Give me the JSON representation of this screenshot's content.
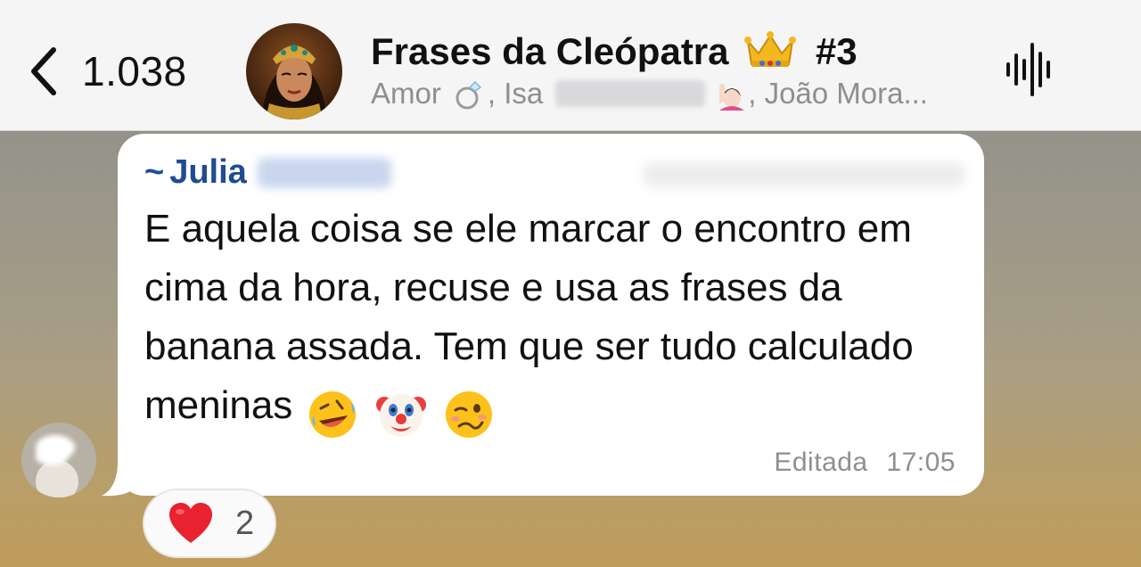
{
  "header": {
    "back_count": "1.038",
    "group_name": "Frases da Cleópatra",
    "title_suffix": "#3",
    "participants": {
      "first": "Amor",
      "second": "Isa",
      "third": "João Mora..."
    },
    "icons": {
      "back": "chevron-left-icon",
      "title_emoji": "crown-icon",
      "voice": "audio-waveform-icon"
    }
  },
  "message": {
    "sender": "Julia",
    "text": "E aquela coisa se ele marcar o encontro em cima da hora, recuse e usa as frases da banana assada. Tem que ser tudo calculado meninas",
    "emojis": [
      "rolling-on-floor-laughing-icon",
      "clown-face-icon",
      "woozy-face-icon"
    ],
    "edited_label": "Editada",
    "time": "17:05"
  },
  "reaction": {
    "emoji": "red-heart-icon",
    "count": "2"
  },
  "colors": {
    "header_bg": "#f5f5f5",
    "sender_name": "#1f4c92",
    "bubble_bg": "#ffffff",
    "meta_text": "#8e8e93"
  }
}
